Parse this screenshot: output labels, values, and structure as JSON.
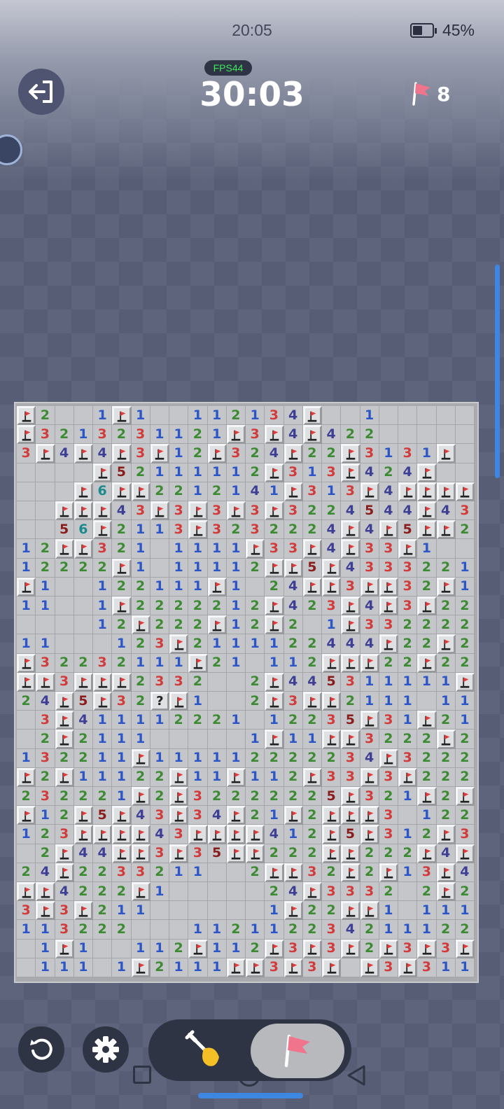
{
  "status": {
    "time": "20:05",
    "battery": "45%",
    "battery_level": 0.45
  },
  "hud": {
    "fps": "FPS44",
    "timer": "30:03",
    "flags_left": "8"
  },
  "board": {
    "cols": 24,
    "rows": 30,
    "legend": {
      "F": "flagged cell",
      "C": "covered cell",
      "?": "question mark",
      ".": "revealed empty",
      "1-8": "adjacent mine count"
    },
    "cells": [
      "F2..1F1..112134F..1.....C",
      "F3213231121F3F4F422.....C",
      "3F4F4F3F12F324F22F3131F..",
      "....F52111112F313F424F...",
      "...F6FF2212141F313F4FFFFF",
      "..FFF43F3F3F3F3224544F432",
      "..56F2113F3232224F4F5FF2.",
      "12FF321.1111F33F4F33F1...",
      "12222F1.11112FF5F4333221.",
      "F1..122111F1.24FF3FF32F1.",
      "11..1F2222212F423F4F3F221",
      "....12F222F12F2.1F332222F",
      "11...123F2111122444F22F21",
      "F32232111F21.112FFF22F221",
      "FF3FFF2332..2F445311111F.",
      "24F5F32?F1..2F3FF2111.11.",
      ".3F411112221.12235F31F21.",
      ".2F2111.....1F11FF3222F211",
      "132211F111112222234F3222F1",
      "F2F11122F11F112F33F3F2221",
      "232221F2F32222225F321F2F1",
      "F12F5F43F34F21F2FFF3.1221",
      "123FFFF43FFFF412F5F312F321",
      ".2F44FF3F35FF222FF222F4FFF2",
      "24F2233211..2FF32F2F13F42F4F",
      "FF4222F1.....24F3332.2F2.2F",
      "3F3F211......1F22FF1.11112.22",
      "113222...112112234211122F1",
      ".1F1..112F112F3F3F2F3F3F21",
      ".111.1F2111FF3F3F.F3F311.."
    ]
  },
  "controls": {
    "exit": "exit-game",
    "restart": "restart",
    "settings": "settings",
    "dig_mode": "shovel",
    "flag_mode": "flag",
    "active_mode": "flag"
  },
  "colors": {
    "n1": "#2c55c8",
    "n2": "#3c8a32",
    "n3": "#d33a3a",
    "n4": "#3e3f94",
    "n5": "#8a1c1c",
    "n6": "#1c8a8c",
    "accent": "#3d87e2",
    "fps": "#3ce85a"
  }
}
